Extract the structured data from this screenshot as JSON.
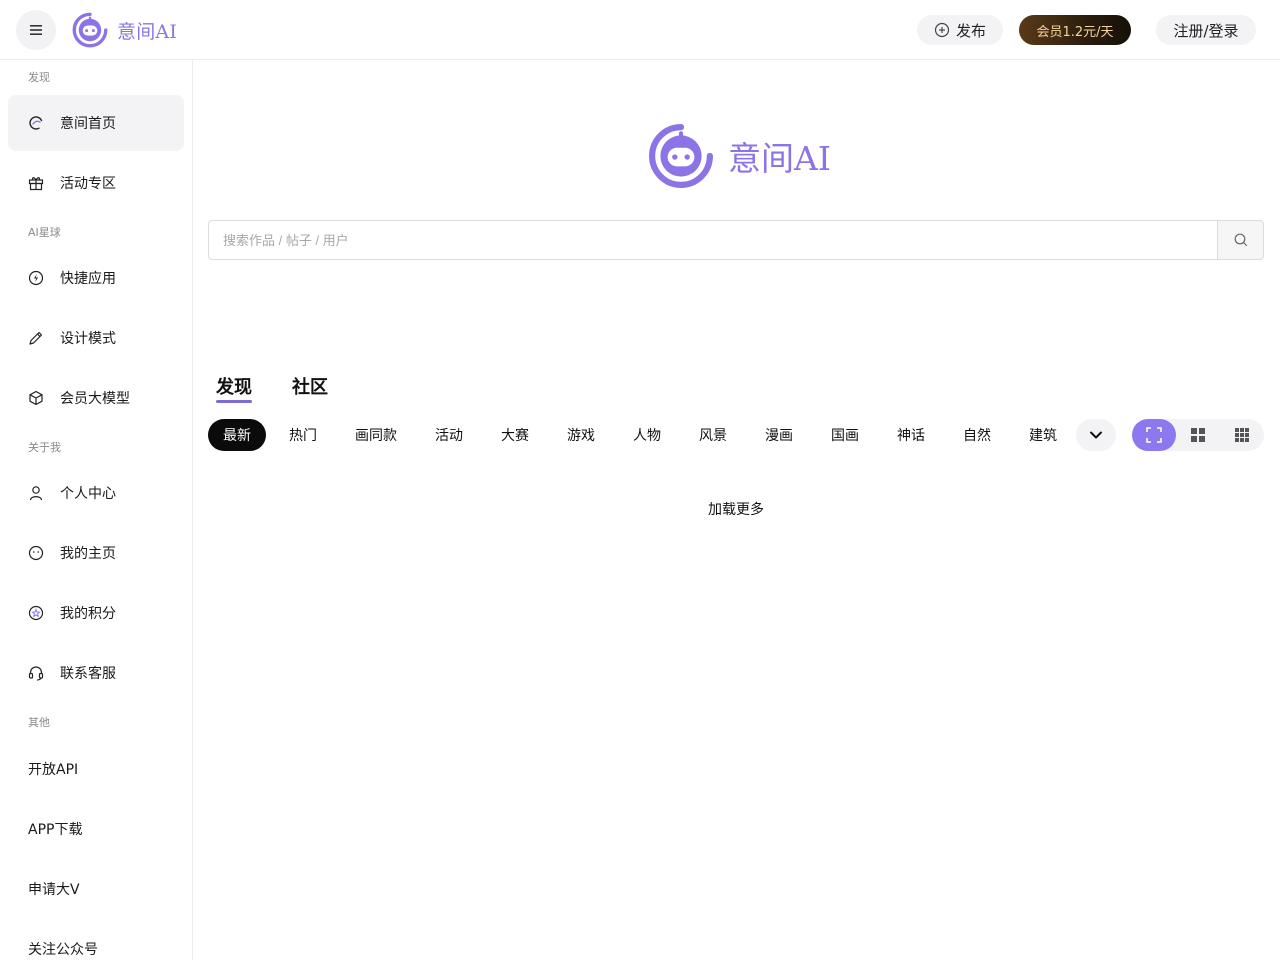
{
  "header": {
    "brand_name": "意间AI",
    "publish_label": "发布",
    "vip_label": "会员1.2元/天",
    "login_label": "注册/登录"
  },
  "sidebar": {
    "sections": [
      {
        "label": "发现"
      },
      {
        "label": "AI星球"
      },
      {
        "label": "关于我"
      },
      {
        "label": "其他"
      }
    ],
    "items": [
      {
        "label": "意间首页",
        "icon": "home-swirl-icon"
      },
      {
        "label": "活动专区",
        "icon": "gift-icon"
      },
      {
        "label": "快捷应用",
        "icon": "lightning-circle-icon"
      },
      {
        "label": "设计模式",
        "icon": "pencil-icon"
      },
      {
        "label": "会员大模型",
        "icon": "cube-icon"
      },
      {
        "label": "个人中心",
        "icon": "user-icon"
      },
      {
        "label": "我的主页",
        "icon": "smile-circle-icon"
      },
      {
        "label": "我的积分",
        "icon": "star-circle-icon"
      },
      {
        "label": "联系客服",
        "icon": "headset-icon"
      }
    ],
    "links": [
      {
        "label": "开放API"
      },
      {
        "label": "APP下载"
      },
      {
        "label": "申请大V"
      },
      {
        "label": "关注公众号"
      }
    ]
  },
  "main": {
    "hero_name": "意间AI",
    "search": {
      "placeholder": "搜索作品 / 帖子 / 用户",
      "value": ""
    },
    "tabs": [
      {
        "label": "发现"
      },
      {
        "label": "社区"
      }
    ],
    "categories": [
      {
        "label": "最新"
      },
      {
        "label": "热门"
      },
      {
        "label": "画同款"
      },
      {
        "label": "活动"
      },
      {
        "label": "大赛"
      },
      {
        "label": "游戏"
      },
      {
        "label": "人物"
      },
      {
        "label": "风景"
      },
      {
        "label": "漫画"
      },
      {
        "label": "国画"
      },
      {
        "label": "神话"
      },
      {
        "label": "自然"
      },
      {
        "label": "建筑"
      }
    ],
    "load_more_label": "加载更多"
  },
  "colors": {
    "accent": "#8e78f0",
    "brand_text": "#8d74e6",
    "vip_text": "#f3d4a0"
  }
}
